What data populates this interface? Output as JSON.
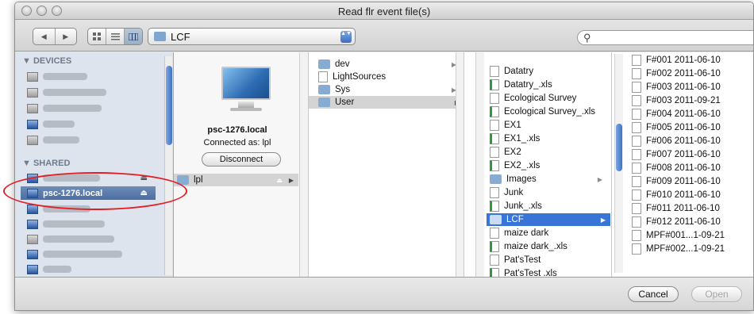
{
  "window": {
    "title": "Read flr event file(s)"
  },
  "toolbar": {
    "back_icon": "◀",
    "forward_icon": "▶",
    "view_icons": [
      "icon-view-icon",
      "list-view-icon",
      "column-view-icon"
    ],
    "location": "LCF",
    "popup_arrows": "▲▼",
    "search_value": "",
    "search_icon": "⚲"
  },
  "sidebar": {
    "devices_header": "▼ DEVICES",
    "shared_header": "▼ SHARED",
    "selected_item": "psc-1276.local",
    "eject_icon": "⏏"
  },
  "connected_server": {
    "name": "psc-1276.local",
    "status": "Connected as: lpl",
    "disconnect_label": "Disconnect",
    "share": "lpl"
  },
  "column1": [
    {
      "name": "dev",
      "type": "folder",
      "arrow": "▶"
    },
    {
      "name": "LightSources",
      "type": "file"
    },
    {
      "name": "Sys",
      "type": "folder",
      "arrow": "▶"
    },
    {
      "name": "User",
      "type": "folder",
      "arrow": "▶"
    }
  ],
  "column2": [
    {
      "name": "Datatry",
      "type": "file"
    },
    {
      "name": "Datatry_.xls",
      "type": "xls"
    },
    {
      "name": "Ecological Survey",
      "type": "file"
    },
    {
      "name": "Ecological Survey_.xls",
      "type": "xls"
    },
    {
      "name": "EX1",
      "type": "file"
    },
    {
      "name": "EX1_.xls",
      "type": "xls"
    },
    {
      "name": "EX2",
      "type": "file"
    },
    {
      "name": "EX2_.xls",
      "type": "xls"
    },
    {
      "name": "Images",
      "type": "folder",
      "arrow": "▶"
    },
    {
      "name": "Junk",
      "type": "file"
    },
    {
      "name": "Junk_.xls",
      "type": "xls"
    },
    {
      "name": "LCF",
      "type": "folder",
      "arrow": "▶"
    },
    {
      "name": "maize dark",
      "type": "file"
    },
    {
      "name": "maize dark_.xls",
      "type": "xls"
    },
    {
      "name": "Pat'sTest",
      "type": "file"
    },
    {
      "name": "Pat'sTest .xls",
      "type": "xls"
    }
  ],
  "column3": [
    "F#001 2011-06-10",
    "F#002 2011-06-10",
    "F#003 2011-06-10",
    "F#003 2011-09-21",
    "F#004 2011-06-10",
    "F#005 2011-06-10",
    "F#006 2011-06-10",
    "F#007 2011-06-10",
    "F#008 2011-06-10",
    "F#009 2011-06-10",
    "F#010 2011-06-10",
    "F#011 2011-06-10",
    "F#012 2011-06-10",
    "MPF#001...1-09-21",
    "MPF#002...1-09-21"
  ],
  "footer": {
    "cancel_label": "Cancel",
    "open_label": "Open"
  },
  "colors": {
    "selection": "#3875d7",
    "sidebar_bg": "#dde4ed",
    "highlight_oval": "#e31e24"
  }
}
